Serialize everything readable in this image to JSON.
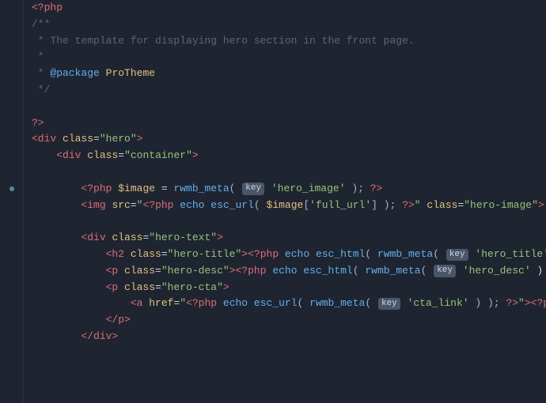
{
  "editor": {
    "background": "#1e2530",
    "lines": [
      {
        "id": 1,
        "has_dot": false,
        "content": "php_open"
      },
      {
        "id": 2,
        "has_dot": false,
        "content": "comment_start"
      },
      {
        "id": 3,
        "has_dot": false,
        "content": "comment_template"
      },
      {
        "id": 4,
        "has_dot": false,
        "content": "comment_star"
      },
      {
        "id": 5,
        "has_dot": false,
        "content": "comment_package"
      },
      {
        "id": 6,
        "has_dot": false,
        "content": "comment_end"
      },
      {
        "id": 7,
        "has_dot": false,
        "content": "empty"
      },
      {
        "id": 8,
        "has_dot": false,
        "content": "php_close"
      },
      {
        "id": 9,
        "has_dot": false,
        "content": "div_hero"
      },
      {
        "id": 10,
        "has_dot": false,
        "content": "div_container"
      },
      {
        "id": 11,
        "has_dot": false,
        "content": "empty2"
      },
      {
        "id": 12,
        "has_dot": true,
        "content": "php_image"
      },
      {
        "id": 13,
        "has_dot": false,
        "content": "img_tag"
      },
      {
        "id": 14,
        "has_dot": false,
        "content": "empty3"
      },
      {
        "id": 15,
        "has_dot": false,
        "content": "div_hero_text"
      },
      {
        "id": 16,
        "has_dot": false,
        "content": "h2_tag"
      },
      {
        "id": 17,
        "has_dot": false,
        "content": "p_desc"
      },
      {
        "id": 18,
        "has_dot": false,
        "content": "p_cta"
      },
      {
        "id": 19,
        "has_dot": false,
        "content": "a_href"
      },
      {
        "id": 20,
        "has_dot": false,
        "content": "close_p"
      },
      {
        "id": 21,
        "has_dot": false,
        "content": "close_div"
      }
    ],
    "key_badge_text": "key"
  }
}
